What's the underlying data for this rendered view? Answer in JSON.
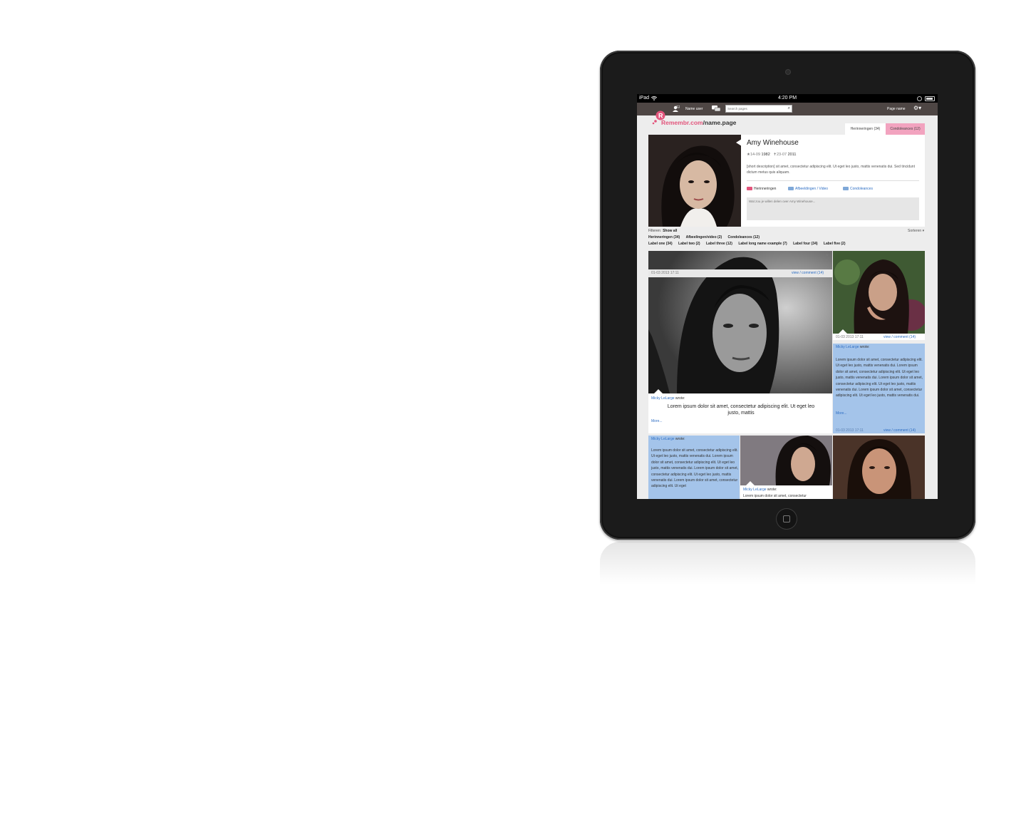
{
  "status_bar": {
    "carrier": "iPad",
    "time": "4:20 PM"
  },
  "topbar": {
    "user_name": "Name user",
    "search_placeholder": "Search pages",
    "page_name": "Page name"
  },
  "brand": {
    "site": "Remembr.com",
    "page": "/name.page"
  },
  "tabs": [
    {
      "label": "Herinneringen (34)"
    },
    {
      "label": "Condoleances (12)"
    }
  ],
  "profile": {
    "name": "Amy Winehouse",
    "birth_prefix": "14-09",
    "birth_year": "1982",
    "death_prefix": "23-07",
    "death_year": "2011",
    "description": "[short description] sit amet, consectetur adipiscing elit. Ut eget leo justo, mattis venenatis dui. Sed tincidunt dictum metus quis aliquam.",
    "actions": [
      {
        "label": "Herinneringen"
      },
      {
        "label": "Afbeeldingen / Video"
      },
      {
        "label": "Condoleances"
      }
    ],
    "share_placeholder": "Wat zou je willen delen over Amy Winehouse..."
  },
  "filters": {
    "label": "Filteren:",
    "show_all": "Show all",
    "sort": "Sorteren ▾",
    "types": [
      "Herinneringen (34)",
      "Afbeelingen/video (2)",
      "Condoleances (12)"
    ],
    "labels": [
      "Label one (34)",
      "Label two (2)",
      "Label three (12)",
      "Label long name example (7)",
      "Label four (34)",
      "Label five (2)"
    ]
  },
  "posts": {
    "author": "Micky LeLarge",
    "wrote": "wrote:",
    "big_caption": "Lorem ipsum dolor sit amet, consectetur adipiscing elit. Ut eget leo justo, mattis",
    "more": "More...",
    "date": "01-03 2013 17:11",
    "view_comment": "view / comment (14)",
    "long_text": "Lorem ipsum dolor sit amet, consectetur adipiscing elit. Ut eget leo justo, mattis venenatis dui.  Lorem ipsum dolor sit amet, consectetur adipiscing elit. Ut eget leo justo, mattis venenatis dui. Lorem ipsum dolor sit amet, consectetur adipiscing elit. Ut eget leo justo, mattis venenatis dui. Lorem ipsum dolor sit amet, consectetur adipiscing elit. Ut eget leo justo, mattis venenatis dui.",
    "col2_text": "Lorem ipsum dolor sit amet, consectetur adipiscing elit. Ut eget leo justo, mattis venenatis dui.  Lorem ipsum dolor sit amet, consectetur adipiscing elit. Ut eget leo justo, mattis venenatis dui. Lorem ipsum dolor sit amet, consectetur adipiscing elit. Ut eget leo justo, mattis venenatis dui. Lorem ipsum dolor sit amet, consectetur adipiscing elit. Ut eget",
    "short_text": "Lorem ipsum dolor sit amet, consectetur"
  },
  "colors": {
    "brand_pink": "#e2557c",
    "topbar": "#4e4644",
    "post_blue": "#a4c4ea",
    "link_blue": "#2f6fc4"
  }
}
